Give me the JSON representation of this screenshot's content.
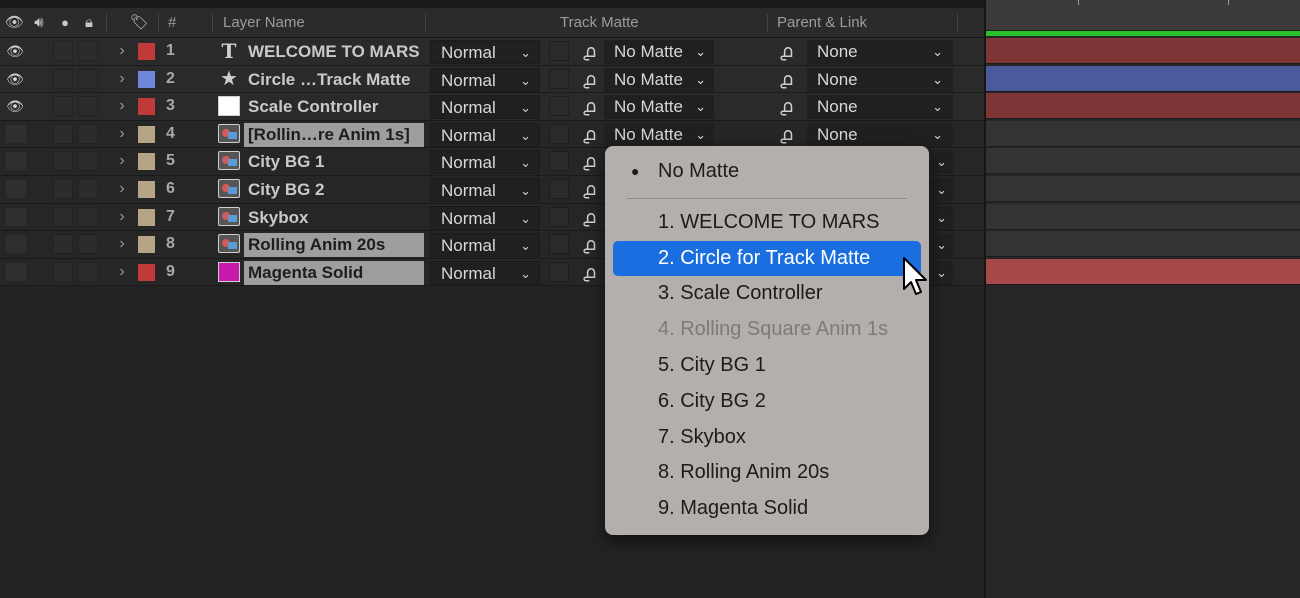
{
  "header": {
    "hash_label": "#",
    "layer_name_label": "Layer Name",
    "track_matte_label": "Track Matte",
    "parent_label": "Parent & Link",
    "icons": [
      "eye-icon",
      "speaker-icon",
      "solo-dot-icon",
      "lock-icon",
      "label-tag-icon"
    ]
  },
  "layers": [
    {
      "num": "1",
      "name": "WELCOME TO MARS",
      "type": "text",
      "label_color": "#c03a3a",
      "mode": "Normal",
      "matte": "No Matte",
      "parent": "None",
      "visible": true,
      "selected": false,
      "track_color": "#7e3536"
    },
    {
      "num": "2",
      "name": "Circle …Track Matte",
      "type": "shape",
      "label_color": "#6f86d9",
      "mode": "Normal",
      "matte": "No Matte",
      "parent": "None",
      "visible": true,
      "selected": false,
      "track_color": "#4a5a9a"
    },
    {
      "num": "3",
      "name": "Scale Controller",
      "type": "solid-white",
      "label_color": "#c03a3a",
      "mode": "Normal",
      "matte": "No Matte",
      "parent": "None",
      "visible": true,
      "selected": false,
      "track_color": "#7e3536"
    },
    {
      "num": "4",
      "name": "[Rollin…re Anim 1s]",
      "type": "comp",
      "label_color": "#b5a486",
      "mode": "Normal",
      "matte": "No Matte",
      "parent": "None",
      "visible": false,
      "selected": true,
      "track_color": ""
    },
    {
      "num": "5",
      "name": "City BG 1",
      "type": "comp",
      "label_color": "#b5a486",
      "mode": "Normal",
      "matte": "",
      "parent": "",
      "visible": false,
      "selected": false,
      "track_color": ""
    },
    {
      "num": "6",
      "name": "City BG 2",
      "type": "comp",
      "label_color": "#b5a486",
      "mode": "Normal",
      "matte": "",
      "parent": "",
      "visible": false,
      "selected": false,
      "track_color": ""
    },
    {
      "num": "7",
      "name": "Skybox",
      "type": "comp",
      "label_color": "#b5a486",
      "mode": "Normal",
      "matte": "",
      "parent": "",
      "visible": false,
      "selected": false,
      "track_color": ""
    },
    {
      "num": "8",
      "name": "Rolling Anim 20s",
      "type": "comp",
      "label_color": "#b5a486",
      "mode": "Normal",
      "matte": "",
      "parent": "",
      "visible": false,
      "selected": true,
      "track_color": ""
    },
    {
      "num": "9",
      "name": "Magenta Solid",
      "type": "solid-magenta",
      "label_color": "#c03a3a",
      "mode": "Normal",
      "matte": "",
      "parent": "",
      "visible": false,
      "selected": true,
      "track_color": "#a8474a"
    }
  ],
  "menu": {
    "current": "No Matte",
    "items": [
      {
        "label": "1. WELCOME TO MARS",
        "state": "normal"
      },
      {
        "label": "2. Circle for Track Matte",
        "state": "active"
      },
      {
        "label": "3. Scale Controller",
        "state": "normal"
      },
      {
        "label": "4. Rolling Square Anim 1s",
        "state": "disabled"
      },
      {
        "label": "5. City BG 1",
        "state": "normal"
      },
      {
        "label": "6. City BG 2",
        "state": "normal"
      },
      {
        "label": "7. Skybox",
        "state": "normal"
      },
      {
        "label": "8. Rolling Anim 20s",
        "state": "normal"
      },
      {
        "label": "9. Magenta Solid",
        "state": "normal"
      }
    ]
  },
  "colors": {
    "accent": "#1a6ee0",
    "work_area": "#2bbf2b",
    "magenta_solid": "#c61aa8"
  }
}
